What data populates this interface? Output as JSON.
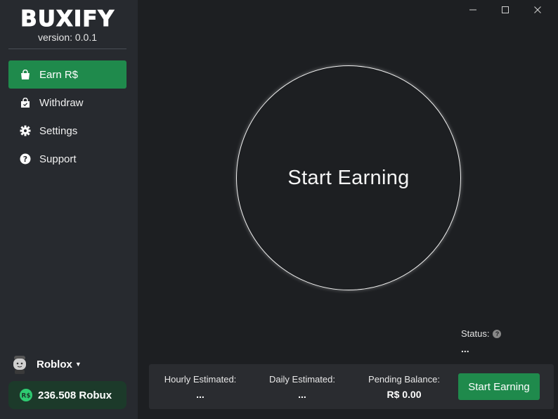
{
  "app": {
    "name": "BUXIFY",
    "version": "version: 0.0.1"
  },
  "sidebar": {
    "items": [
      {
        "label": "Earn R$",
        "icon": "bag-icon",
        "active": true
      },
      {
        "label": "Withdraw",
        "icon": "shopping-bag-check-icon",
        "active": false
      },
      {
        "label": "Settings",
        "icon": "gear-icon",
        "active": false
      },
      {
        "label": "Support",
        "icon": "question-circle-icon",
        "active": false
      }
    ],
    "user": {
      "name": "Roblox"
    },
    "balance": {
      "text": "236.508 Robux"
    }
  },
  "window_controls": {
    "minimize": "—",
    "maximize": "☐",
    "close": "✕"
  },
  "main": {
    "circle_label": "Start Earning",
    "status": {
      "label": "Status:",
      "value": "..."
    },
    "stats": {
      "hourly": {
        "label": "Hourly Estimated:",
        "value": "..."
      },
      "daily": {
        "label": "Daily Estimated:",
        "value": "..."
      },
      "pending": {
        "label": "Pending Balance:",
        "value": "R$ 0.00"
      }
    },
    "start_button": "Start Earning"
  },
  "colors": {
    "accent": "#1f8a4c",
    "sidebar_bg": "#272a2f",
    "main_bg": "#1d1f22",
    "bar_bg": "#2a2c30"
  }
}
